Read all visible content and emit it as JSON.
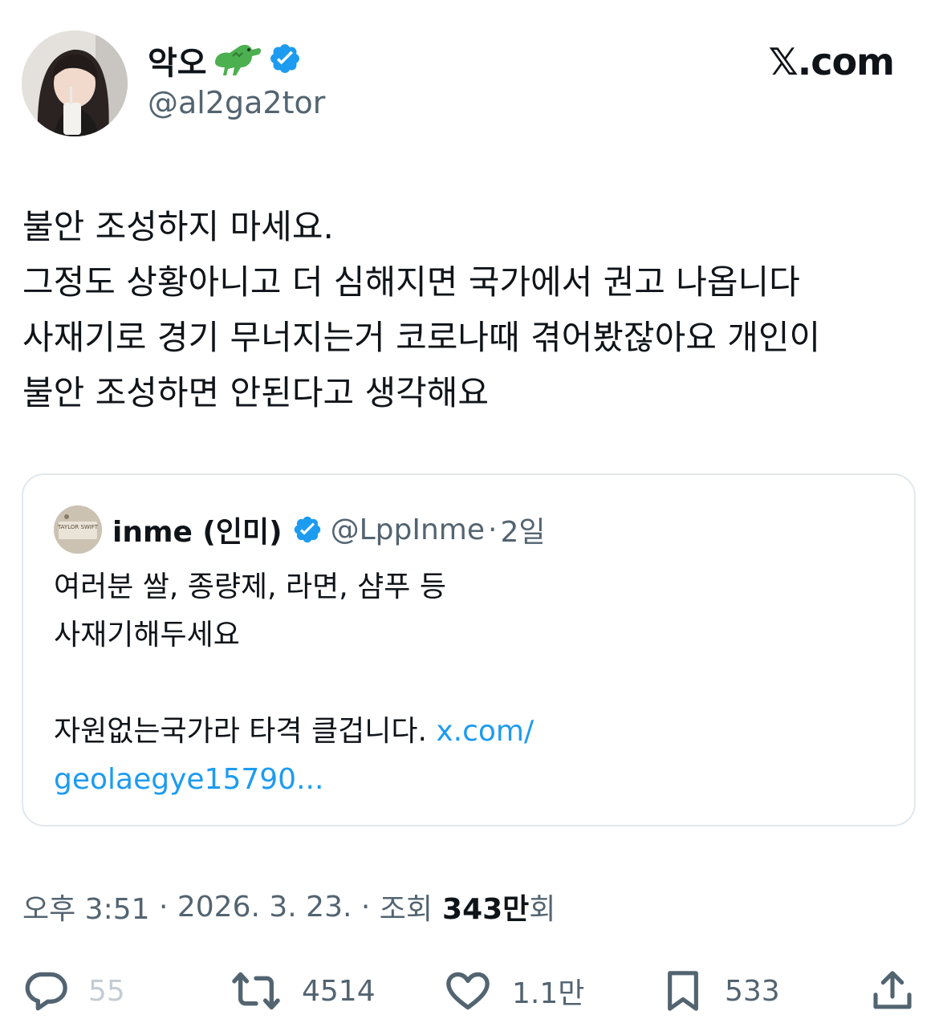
{
  "author": {
    "display_name": "악오",
    "name_emoji": "crocodile-emoji",
    "verified": true,
    "handle": "@al2ga2tor"
  },
  "brand": {
    "logo_text": "𝕏.com"
  },
  "tweet": {
    "lines": [
      "불안 조성하지 마세요.",
      "그정도 상황아니고 더 심해지면 국가에서 권고 나옵니다",
      "사재기로 경기 무너지는거 코로나때 겪어봤잖아요 개인이",
      "불안 조성하면 안된다고 생각해요"
    ]
  },
  "quote": {
    "display_name": "inme (인미)",
    "verified": true,
    "handle": "@LppInme",
    "separator": "·",
    "time": "2일",
    "avatar_text": "TAYLOR SWIFT",
    "lines": [
      "여러분 쌀, 종량제, 라면, 샴푸 등",
      "사재기해두세요",
      "",
      "자원없는국가라 타격 클겁니다."
    ],
    "link_part1": "x.com/",
    "link_part2": "geolaegye15790..."
  },
  "meta": {
    "time": "오후 3:51",
    "separator": " · ",
    "date": "2026. 3. 23.",
    "views_label": "조회",
    "views_count": "343만",
    "views_suffix": "회"
  },
  "actions": {
    "replies": "55",
    "retweets": "4514",
    "likes": "1.1만",
    "bookmarks": "533"
  },
  "colors": {
    "text": "#0f1419",
    "secondary": "#536471",
    "link": "#1d9bf0",
    "verified": "#1d9bf0",
    "border": "#e1e8ed"
  }
}
